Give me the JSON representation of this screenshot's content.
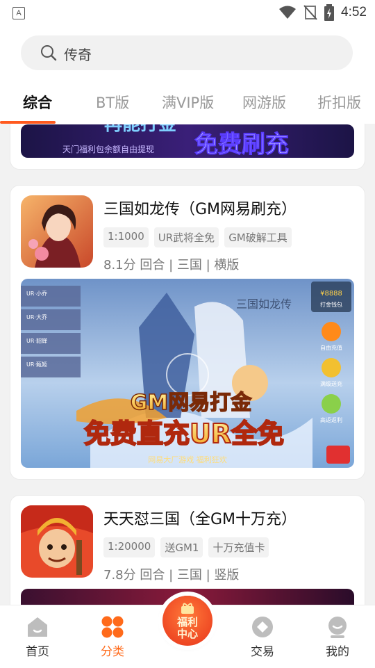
{
  "status_bar": {
    "left_indicator": "A",
    "time": "4:52"
  },
  "search": {
    "value": "传奇"
  },
  "tabs": [
    {
      "label": "综合",
      "active": true
    },
    {
      "label": "BT版",
      "active": false
    },
    {
      "label": "满VIP版",
      "active": false
    },
    {
      "label": "网游版",
      "active": false
    },
    {
      "label": "折扣版",
      "active": false
    }
  ],
  "first_card": {
    "banner_text_main": "免费刷充",
    "banner_text_top": "再能打金",
    "banner_subtext": "天门福利包余额自由提现"
  },
  "games": [
    {
      "title": "三国如龙传（GM网易刷充）",
      "tags": [
        "1:1000",
        "UR武将全免",
        "GM破解工具"
      ],
      "meta": "8.1分 回合 | 三国 | 横版",
      "banner": {
        "heading": "GM网易打金",
        "big": "免费直充UR全免",
        "footer": "网易大厂游戏 福利狂欢",
        "game_logo": "三国如龙传",
        "side_items": [
          "打金钱包",
          "自由充值",
          "满级送充",
          "高返返利"
        ],
        "side_values": [
          "¥8888"
        ],
        "cards": [
          "UR·小乔",
          "UR·大乔",
          "UR·貂蝉",
          "UR·甄姬"
        ]
      }
    },
    {
      "title": "天天怼三国（全GM十万充）",
      "tags": [
        "1:20000",
        "送GM1",
        "十万充值卡"
      ],
      "meta": "7.8分 回合 | 三国 | 竖版"
    }
  ],
  "bottom_nav": {
    "items": [
      {
        "label": "首页",
        "icon": "home-icon",
        "active": false
      },
      {
        "label": "分类",
        "icon": "category-icon",
        "active": true
      },
      {
        "label": "交易",
        "icon": "trade-icon",
        "active": false
      },
      {
        "label": "我的",
        "icon": "profile-icon",
        "active": false
      }
    ],
    "center": {
      "line1": "福利",
      "line2": "中心"
    }
  },
  "colors": {
    "accent": "#ff6a1a",
    "underline": "#ff5a1f"
  }
}
